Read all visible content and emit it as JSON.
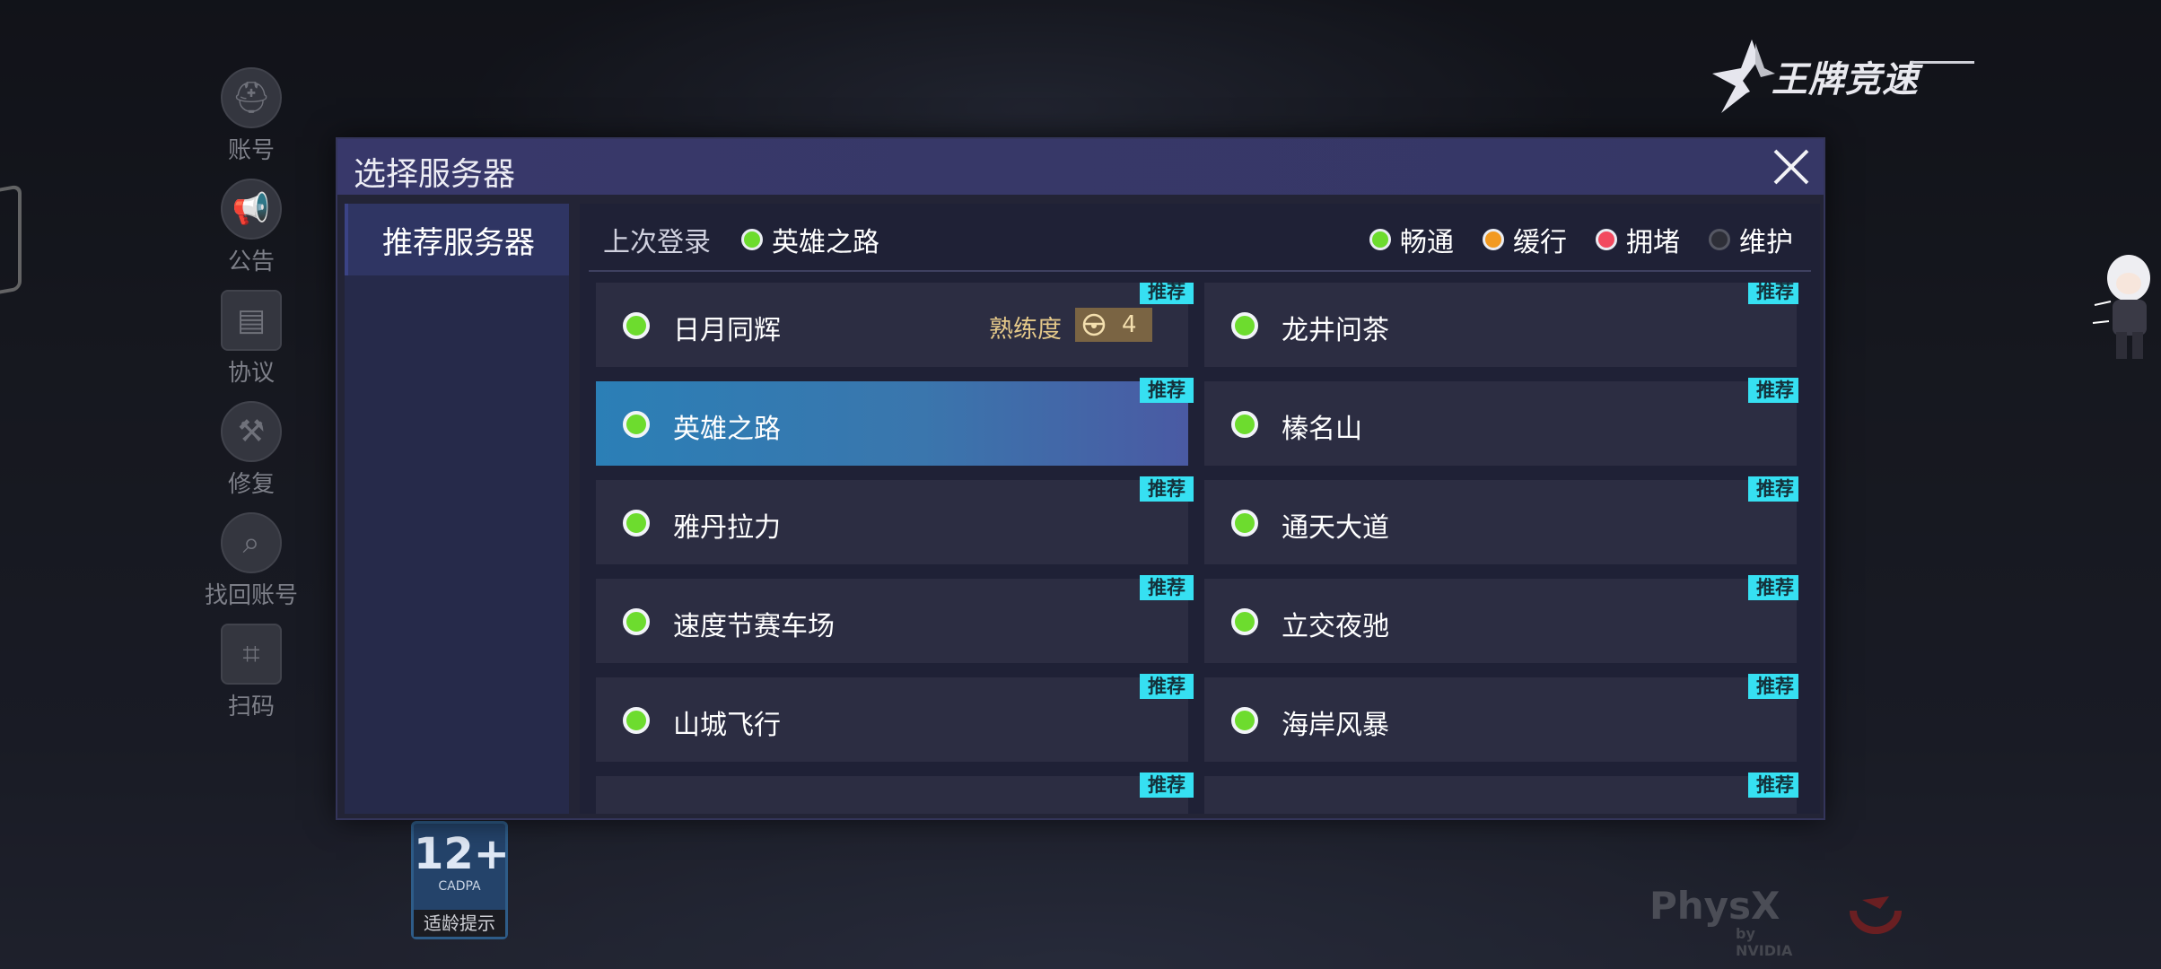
{
  "side_menu": [
    {
      "label": "账号",
      "icon": "helmet-icon"
    },
    {
      "label": "公告",
      "icon": "megaphone-icon"
    },
    {
      "label": "协议",
      "icon": "document-icon"
    },
    {
      "label": "修复",
      "icon": "wrench-icon"
    },
    {
      "label": "找回账号",
      "icon": "account-search-icon"
    },
    {
      "label": "扫码",
      "icon": "scan-icon"
    }
  ],
  "logo": {
    "text": "王牌竞速"
  },
  "modal": {
    "title": "选择服务器",
    "close_icon": "close-icon",
    "tabs": [
      {
        "label": "推荐服务器",
        "active": true
      }
    ],
    "last_login_label": "上次登录",
    "last_login_server": "英雄之路",
    "legend": [
      {
        "label": "畅通",
        "color": "#6ddc2e"
      },
      {
        "label": "缓行",
        "color": "#f29a21"
      },
      {
        "label": "拥堵",
        "color": "#f24a5f"
      },
      {
        "label": "维护",
        "color": "#2e2f38"
      }
    ],
    "servers": [
      {
        "name": "日月同辉",
        "tag": "推荐",
        "status": "畅通",
        "proficiency_label": "熟练度",
        "proficiency_value": "4"
      },
      {
        "name": "龙井问茶",
        "tag": "推荐",
        "status": "畅通"
      },
      {
        "name": "英雄之路",
        "tag": "推荐",
        "status": "畅通",
        "selected": true
      },
      {
        "name": "榛名山",
        "tag": "推荐",
        "status": "畅通"
      },
      {
        "name": "雅丹拉力",
        "tag": "推荐",
        "status": "畅通"
      },
      {
        "name": "通天大道",
        "tag": "推荐",
        "status": "畅通"
      },
      {
        "name": "速度节赛车场",
        "tag": "推荐",
        "status": "畅通"
      },
      {
        "name": "立交夜驰",
        "tag": "推荐",
        "status": "畅通"
      },
      {
        "name": "山城飞行",
        "tag": "推荐",
        "status": "畅通"
      },
      {
        "name": "海岸风暴",
        "tag": "推荐",
        "status": "畅通"
      },
      {
        "name": "",
        "tag": "推荐"
      },
      {
        "name": "",
        "tag": "推荐"
      }
    ]
  },
  "age_badge": {
    "age": "12+",
    "org": "CADPA",
    "text": "适龄提示"
  },
  "physx": {
    "main": "PhysX",
    "sub": "by NVIDIA"
  }
}
